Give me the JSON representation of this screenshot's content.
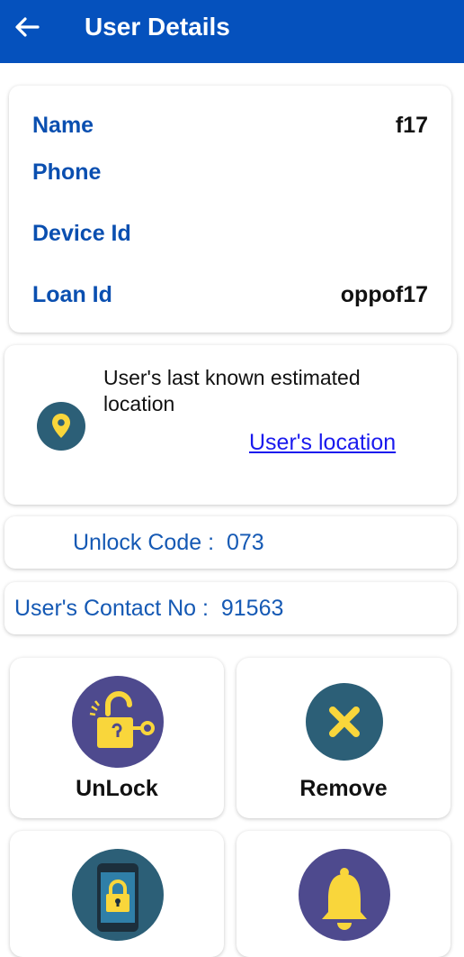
{
  "header": {
    "title": "User Details",
    "back_icon": "arrow-left-icon"
  },
  "user_info": {
    "name_label": "Name",
    "name_value": "f17",
    "phone_label": "Phone",
    "phone_value": "",
    "device_label": "Device Id",
    "device_value": "",
    "loan_label": "Loan Id",
    "loan_value": "oppof17"
  },
  "location": {
    "text": "User's last known estimated location",
    "link": "User's location",
    "icon": "location-pin-icon"
  },
  "unlock_code": {
    "label": "Unlock Code :",
    "value": "073"
  },
  "contact": {
    "label": "User's Contact No :",
    "value": "91563"
  },
  "actions": [
    {
      "label": "UnLock",
      "icon": "unlock-icon",
      "color": "#4e4a8e"
    },
    {
      "label": "Remove",
      "icon": "close-icon",
      "color": "#2c5f77"
    },
    {
      "label": "",
      "icon": "phone-lock-icon",
      "color": "#2c5f77"
    },
    {
      "label": "",
      "icon": "bell-icon",
      "color": "#4e4a8e"
    }
  ],
  "colors": {
    "appbar": "#0551bd",
    "label_blue": "#0a4fb0",
    "accent_yellow": "#f9d63b",
    "link": "#1a1aee"
  }
}
